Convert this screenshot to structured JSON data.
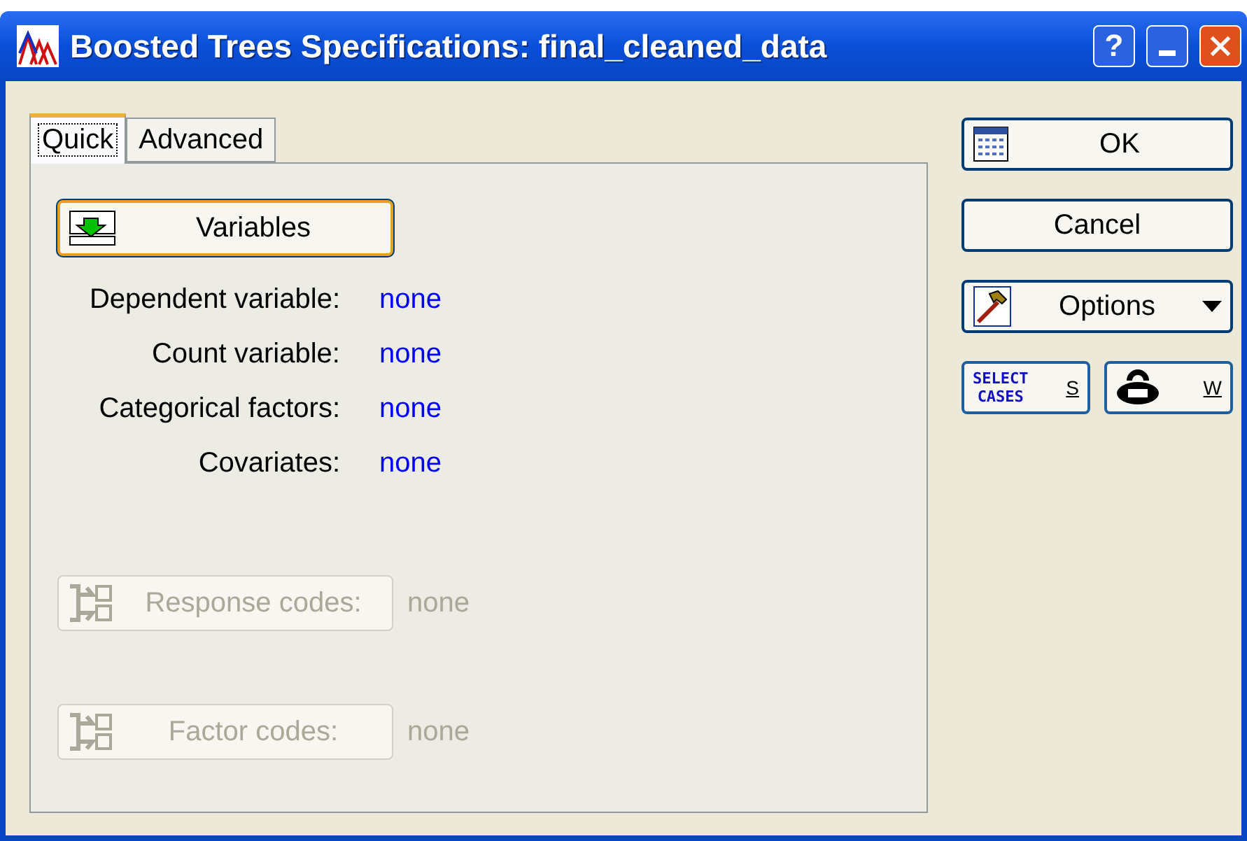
{
  "window": {
    "title": "Boosted Trees Specifications: final_cleaned_data",
    "help": "?"
  },
  "tabs": [
    {
      "label": "Quick",
      "selected": true
    },
    {
      "label": "Advanced",
      "selected": false
    }
  ],
  "variables_button": {
    "label": "Variables"
  },
  "fields": [
    {
      "label": "Dependent variable:",
      "value": "none"
    },
    {
      "label": "Count variable:",
      "value": "none"
    },
    {
      "label": "Categorical factors:",
      "value": "none"
    },
    {
      "label": "Covariates:",
      "value": "none"
    }
  ],
  "code_buttons": [
    {
      "label": "Response codes:",
      "value": "none",
      "disabled": true
    },
    {
      "label": "Factor codes:",
      "value": "none",
      "disabled": true
    }
  ],
  "side_buttons": {
    "ok": "OK",
    "cancel": "Cancel",
    "options": "Options",
    "select_cases": {
      "line_1": "SELECT",
      "line_2": "CASES",
      "key": "S"
    },
    "weight": {
      "key": "W"
    }
  }
}
